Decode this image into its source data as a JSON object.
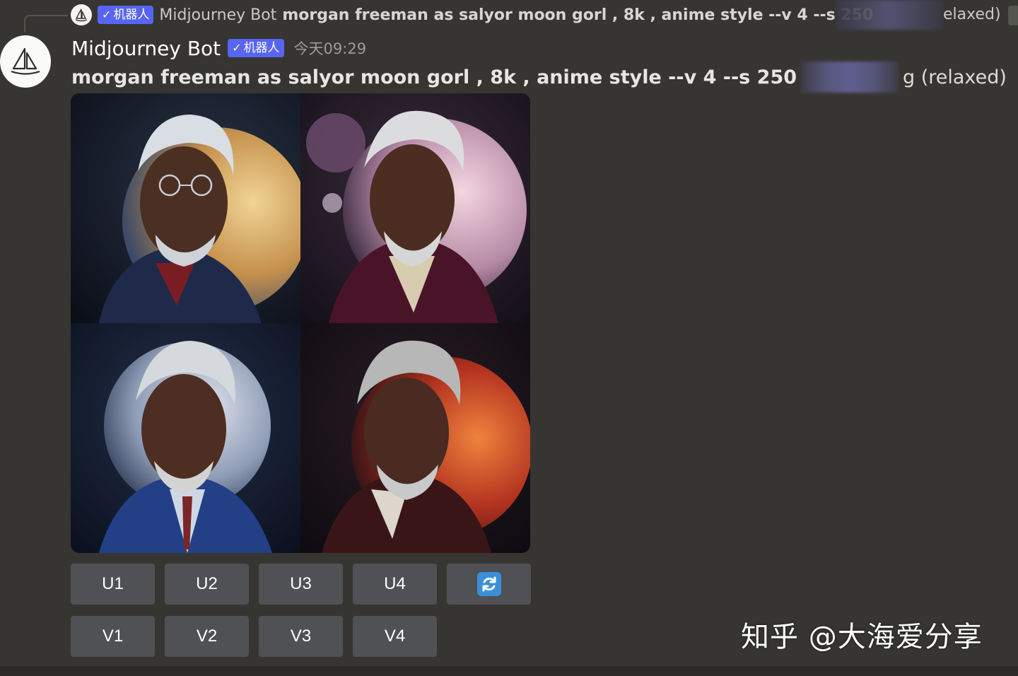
{
  "reply": {
    "bot_tag": "机器人",
    "author": "Midjourney Bot",
    "text": "morgan freeman as salyor moon gorl , 8k , anime style --v 4 --s 250",
    "tail": "elaxed)"
  },
  "message": {
    "author": "Midjourney Bot",
    "bot_tag": "机器人",
    "timestamp": "今天09:29",
    "prompt": "morgan freeman as salyor moon gorl , 8k , anime style --v 4 --s 250",
    "suffix": "g (relaxed)"
  },
  "images": [
    {
      "name": "grid-image-1",
      "moon": "#e9c27a"
    },
    {
      "name": "grid-image-2",
      "moon": "#e8c3d0"
    },
    {
      "name": "grid-image-3",
      "moon": "#c9d3e2"
    },
    {
      "name": "grid-image-4",
      "moon": "#d8502c"
    }
  ],
  "buttons": {
    "row1": [
      "U1",
      "U2",
      "U3",
      "U4"
    ],
    "row2": [
      "V1",
      "V2",
      "V3",
      "V4"
    ],
    "reroll_icon": "refresh-icon"
  },
  "watermark": "知乎 @大海爱分享",
  "colors": {
    "background": "#363531",
    "bot_tag": "#5865f2",
    "button": "#4f5154",
    "reroll_icon_bg": "#3b8fd9"
  }
}
